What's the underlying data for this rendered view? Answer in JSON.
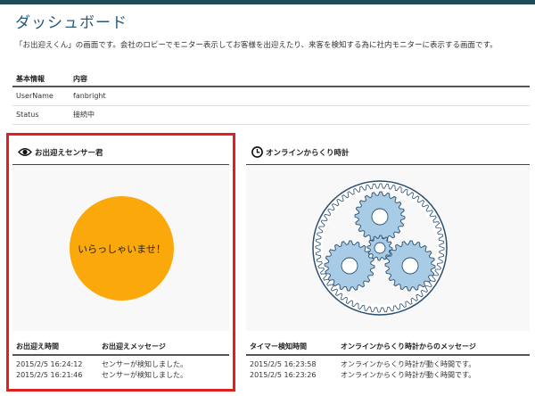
{
  "page": {
    "title": "ダッシュボード",
    "description": "「お出迎えくん」の画面です。会社のロビーでモニター表示してお客様を出迎えたり、来客を検知する為に社内モニターに表示する画面です。"
  },
  "info_table": {
    "headers": [
      "基本情報",
      "内容"
    ],
    "rows": [
      {
        "key": "UserName",
        "value": "fanbright"
      },
      {
        "key": "Status",
        "value": "接続中"
      }
    ]
  },
  "sensor_panel": {
    "title": "お出迎えセンサー君",
    "icon": "eye-icon",
    "greeting": "いらっしゃいませ！",
    "circle_color": "#fba80a",
    "headers": [
      "お出迎え時間",
      "お出迎えメッセージ"
    ],
    "rows": [
      {
        "time": "2015/2/5 16:24:12",
        "message": "センサーが検知しました。"
      },
      {
        "time": "2015/2/5 16:21:46",
        "message": "センサーが検知しました。"
      }
    ]
  },
  "clock_panel": {
    "title": "オンラインからくり時計",
    "icon": "clock-icon",
    "headers": [
      "タイマー検知時間",
      "オンラインからくり時計からのメッセージ"
    ],
    "rows": [
      {
        "time": "2015/2/5 16:23:58",
        "message": "オンラインからくり時計が動く時間です。"
      },
      {
        "time": "2015/2/5 16:23:26",
        "message": "オンラインからくり時計が動く時間です。"
      }
    ]
  },
  "colors": {
    "accent": "#245a7d",
    "highlight_border": "#e02020",
    "gear_fill": "#a8cbe6"
  }
}
